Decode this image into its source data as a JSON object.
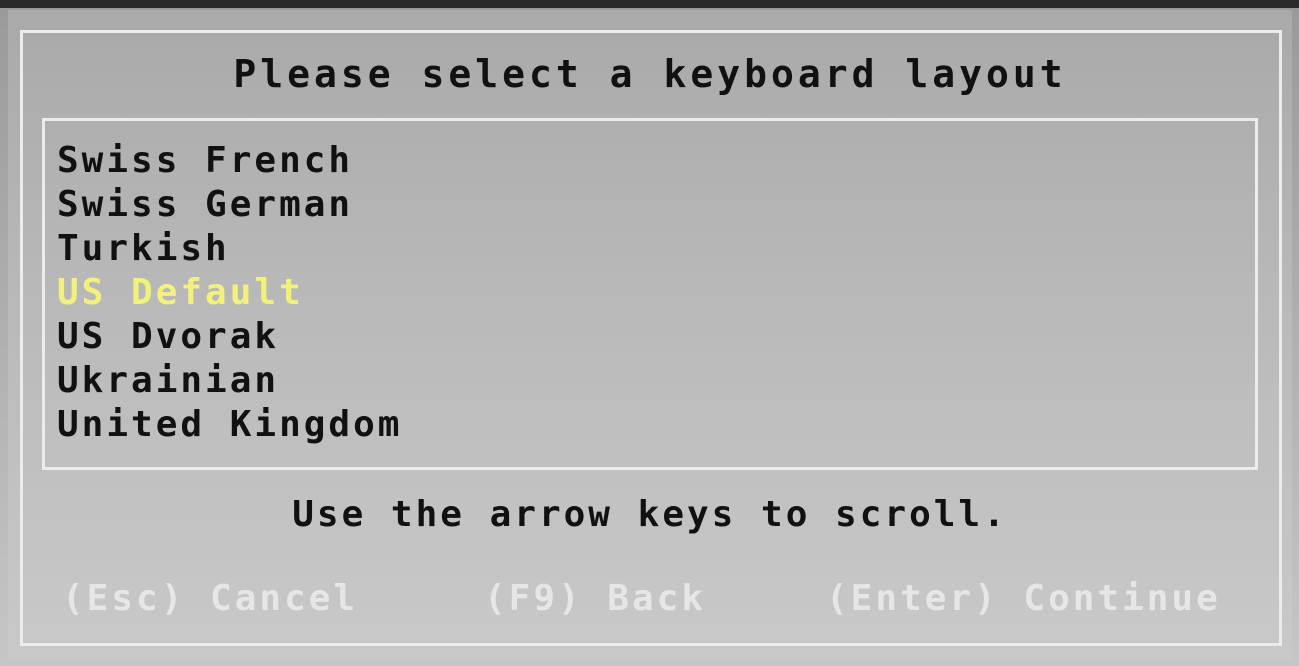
{
  "dialog": {
    "title": "Please select a keyboard layout",
    "hint": "Use the arrow keys to scroll.",
    "selected_color": "#f2f27a"
  },
  "layouts": [
    {
      "label": "Swiss French",
      "selected": false
    },
    {
      "label": "Swiss German",
      "selected": false
    },
    {
      "label": "Turkish",
      "selected": false
    },
    {
      "label": "US Default",
      "selected": true
    },
    {
      "label": "US Dvorak",
      "selected": false
    },
    {
      "label": "Ukrainian",
      "selected": false
    },
    {
      "label": "United Kingdom",
      "selected": false
    }
  ],
  "actions": {
    "cancel": "(Esc) Cancel",
    "back": "(F9) Back",
    "continue": "(Enter) Continue"
  }
}
